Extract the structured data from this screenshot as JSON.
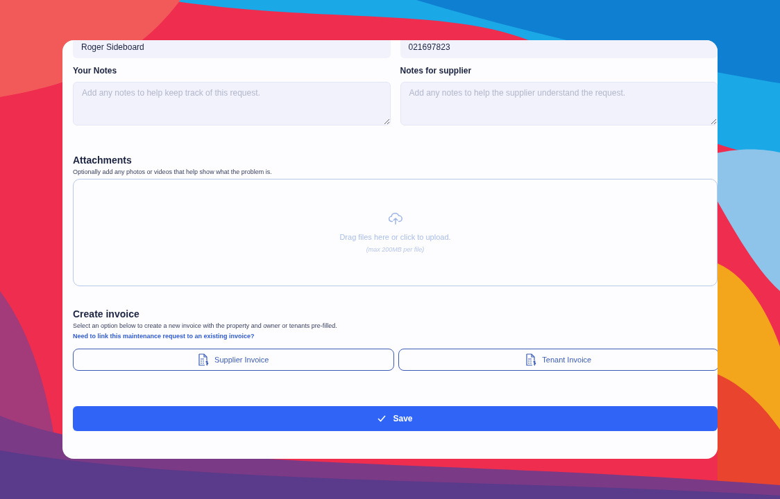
{
  "top_fields": [
    {
      "value": "Roger Sideboard"
    },
    {
      "value": "021697823"
    }
  ],
  "notes": [
    {
      "label": "Your Notes",
      "placeholder": "Add any notes to help keep track of this request."
    },
    {
      "label": "Notes for supplier",
      "placeholder": "Add any notes to help the supplier understand the request."
    }
  ],
  "attachments": {
    "title": "Attachments",
    "description": "Optionally add any photos or videos that help show what the problem is.",
    "drop_text": "Drag files here or click to upload.",
    "limit_text": "(max 200MB per file)"
  },
  "invoice": {
    "title": "Create invoice",
    "description": "Select an option below to create a new invoice with the property and owner or tenants pre-filled.",
    "link": "Need to link this maintenance request to an existing invoice?",
    "buttons": [
      "Supplier Invoice",
      "Tenant Invoice"
    ]
  },
  "save_button": "Save"
}
